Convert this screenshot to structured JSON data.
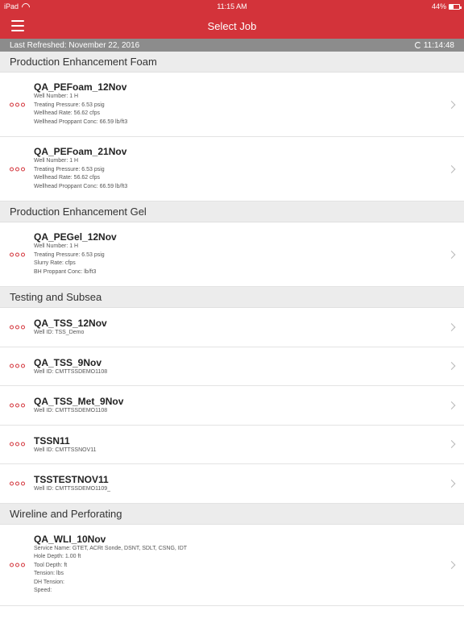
{
  "status_bar": {
    "carrier": "iPad",
    "time": "11:15 AM",
    "battery": "44%"
  },
  "navbar": {
    "title": "Select Job"
  },
  "refresh_bar": {
    "label": "Last Refreshed:",
    "date": "November 22, 2016",
    "time": "11:14:48"
  },
  "sections": [
    {
      "title": "Production Enhancement Foam",
      "jobs": [
        {
          "name": "QA_PEFoam_12Nov",
          "details": [
            "Well Number: 1 H",
            "Treating Pressure: 6.53 psig",
            "Wellhead Rate: 56.62 cfps",
            "Wellhead Proppant Conc: 66.59 lb/ft3"
          ]
        },
        {
          "name": "QA_PEFoam_21Nov",
          "details": [
            "Well Number: 1 H",
            "Treating Pressure: 6.53 psig",
            "Wellhead Rate: 56.62 cfps",
            "Wellhead Proppant Conc: 66.59 lb/ft3"
          ]
        }
      ]
    },
    {
      "title": "Production Enhancement Gel",
      "jobs": [
        {
          "name": "QA_PEGel_12Nov",
          "details": [
            "Well Number: 1 H",
            "Treating Pressure: 6.53 psig",
            "Slurry Rate: cfps",
            "BH Proppant Conc: lb/ft3"
          ]
        }
      ]
    },
    {
      "title": "Testing and Subsea",
      "jobs": [
        {
          "name": "QA_TSS_12Nov",
          "details": [
            "Well ID: TSS_Demo"
          ]
        },
        {
          "name": "QA_TSS_9Nov",
          "details": [
            "Well ID: CMTTSSDEMO1108"
          ]
        },
        {
          "name": "QA_TSS_Met_9Nov",
          "details": [
            "Well ID: CMTTSSDEMO1108"
          ]
        },
        {
          "name": "TSSN11",
          "details": [
            "Well ID: CMTTSSNOV11"
          ]
        },
        {
          "name": "TSSTESTNOV11",
          "details": [
            "Well ID: CMTTSSDEMO1109_"
          ]
        }
      ]
    },
    {
      "title": "Wireline and Perforating",
      "jobs": [
        {
          "name": "QA_WLI_10Nov",
          "details": [
            "Service Name: GTET, ACRt Sonde, DSNT, SDLT, CSNG, IDT",
            "Hole Depth: 1.00 ft",
            "Tool Depth: ft",
            "Tension: lbs",
            "DH Tension:",
            "Speed:"
          ]
        }
      ]
    }
  ]
}
